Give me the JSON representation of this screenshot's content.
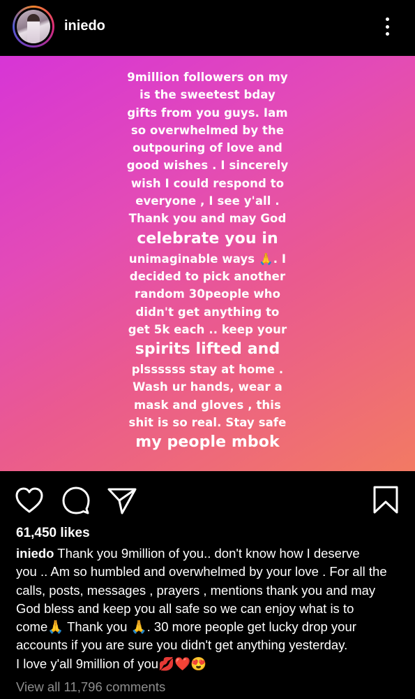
{
  "header": {
    "username": "iniedo"
  },
  "story": {
    "lines": [
      "9million followers on my",
      "is the sweetest bday",
      "gifts from you guys. Iam",
      "so overwhelmed by the",
      "outpouring of love and",
      "good wishes . I sincerely",
      "wish I could respond to",
      "everyone , I see y'all .",
      "Thank you and may God",
      "celebrate you in",
      "unimaginable ways 🙏. I",
      "decided to pick another",
      "random 30people who",
      "didn't get anything to",
      "get 5k each .. keep your",
      "spirits lifted and",
      "plssssss stay at home .",
      "Wash ur hands, wear a",
      "mask and gloves , this",
      "shit is so real. Stay safe",
      "my people mbok"
    ]
  },
  "actions": {
    "like_icon": "heart-outline-icon",
    "comment_icon": "comment-bubble-icon",
    "share_icon": "paper-plane-icon",
    "save_icon": "bookmark-icon"
  },
  "likes": "61,450 likes",
  "caption": {
    "username": "iniedo",
    "lines": [
      "Thank you 9million of you.. don't know how I deserve",
      "you .. Am so humbled and overwhelmed by your love . For all the",
      "calls, posts, messages , prayers , mentions thank you and may",
      "God bless and keep you all safe so we can enjoy what is to",
      "come🙏 Thank you 🙏. 30 more people get lucky drop your",
      "accounts if you are sure you didn't get anything yesterday.",
      "I love y'all 9million of you💋❤️😍"
    ]
  },
  "comments_link": "View all 11,796 comments",
  "colors": {
    "background": "#000000",
    "gradient_start": "#d735d6",
    "gradient_end": "#f27a63",
    "muted_text": "#8e8e8e"
  }
}
